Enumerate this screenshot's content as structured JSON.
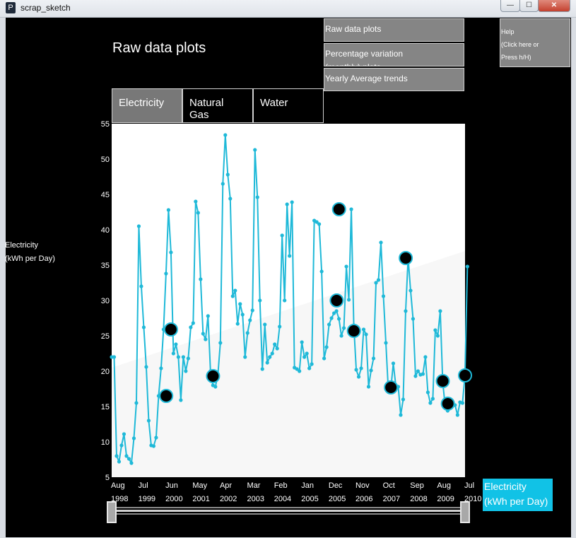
{
  "window": {
    "title": "scrap_sketch",
    "icon_glyph": "P",
    "minimize_glyph": "—",
    "maximize_glyph": "☐",
    "close_glyph": "✕"
  },
  "page": {
    "title": "Raw data plots"
  },
  "nav": {
    "raw": "Raw data plots",
    "percentage_line1": "Percentage variation",
    "percentage_line2": "(monthly) plots",
    "yearly": "Yearly Average trends"
  },
  "help": {
    "line1": "Help",
    "line2": "(Click here or",
    "line3": "Press h/H)"
  },
  "tabs": [
    {
      "label": "Electricity",
      "active": true
    },
    {
      "label": "Natural Gas",
      "active": false
    },
    {
      "label": "Water",
      "active": false
    }
  ],
  "y_title": {
    "line1": "Electricity",
    "line2": "(kWh per Day)"
  },
  "legend": {
    "line1": "Electricity",
    "line2": "(kWh per Day)",
    "color": "#11c2e6"
  },
  "colors": {
    "series": "#1fb9d8",
    "plot_bg": "#ffffff",
    "marker": "#000000"
  },
  "chart_data": {
    "type": "line",
    "title": "",
    "xlabel": "",
    "ylabel": "Electricity (kWh per Day)",
    "ylim": [
      5,
      55
    ],
    "yticks": [
      5,
      10,
      15,
      20,
      25,
      30,
      35,
      40,
      45,
      50,
      55
    ],
    "xlim": [
      1998.58,
      2010.5
    ],
    "xticks": [
      {
        "x": 1998.58,
        "month": "Aug",
        "year": "1998"
      },
      {
        "x": 1999.5,
        "month": "Jul",
        "year": "1999"
      },
      {
        "x": 2000.42,
        "month": "Jun",
        "year": "2000"
      },
      {
        "x": 2001.33,
        "month": "May",
        "year": "2001"
      },
      {
        "x": 2002.25,
        "month": "Apr",
        "year": "2002"
      },
      {
        "x": 2003.17,
        "month": "Mar",
        "year": "2003"
      },
      {
        "x": 2004.08,
        "month": "Feb",
        "year": "2004"
      },
      {
        "x": 2005.0,
        "month": "Jan",
        "year": "2005"
      },
      {
        "x": 2005.92,
        "month": "Dec",
        "year": "2005"
      },
      {
        "x": 2006.83,
        "month": "Nov",
        "year": "2006"
      },
      {
        "x": 2007.75,
        "month": "Oct",
        "year": "2007"
      },
      {
        "x": 2008.67,
        "month": "Sep",
        "year": "2008"
      },
      {
        "x": 2009.58,
        "month": "Aug",
        "year": "2009"
      },
      {
        "x": 2010.5,
        "month": "Jul",
        "year": "2010"
      }
    ],
    "series": [
      {
        "values": [
          22,
          22,
          8,
          7.2,
          9.5,
          11.1,
          8,
          7.6,
          7,
          10.5,
          15.5,
          40.5,
          32,
          26.2,
          20.6,
          13,
          9.5,
          9.4,
          10.6,
          16.5,
          20.4,
          25.9,
          33.8,
          42.8,
          36.8,
          22.5,
          23.8,
          22,
          15.9,
          22,
          20,
          21.8,
          26.2,
          26.8,
          44,
          42.4,
          33,
          25.3,
          24.5,
          27.8,
          20,
          18,
          17.8,
          19.5,
          24,
          46.5,
          53.4,
          47.8,
          44.4,
          30.6,
          31.4,
          26.7,
          29.5,
          28,
          22,
          25.4,
          27.2,
          28.6,
          51.3,
          44.6,
          30,
          20.3,
          26.6,
          21.2,
          22,
          22.5,
          23.8,
          23.2,
          26.3,
          39.2,
          30,
          43.6,
          36.3,
          43.9,
          20.5,
          20.3,
          20,
          24.1,
          22,
          22.5,
          20.4,
          21,
          41.3,
          41.1,
          40.8,
          34.1,
          21.8,
          23.4,
          26.6,
          27.5,
          28.2,
          28.5,
          27.4,
          25,
          26.1,
          34.8,
          30.1,
          42.9,
          26.5,
          20.2,
          19.2,
          20.4,
          25.9,
          25.2,
          17.8,
          20.1,
          21.8,
          32.5,
          32.9,
          38.2,
          30.6,
          24,
          17.2,
          17.5,
          21.1,
          18,
          17.8,
          13.8,
          16,
          28.5,
          36,
          31.4,
          27.4,
          19.3,
          20,
          19.5,
          19.6,
          22,
          17,
          15.5,
          16.1,
          25.8,
          25,
          28.5,
          18.5,
          15,
          14.4,
          15.8,
          15.3,
          15.2,
          13.8,
          15.6,
          15.5,
          19.3,
          34.8
        ]
      }
    ],
    "highlighted": [
      {
        "x": 2000.42,
        "y": 16.5
      },
      {
        "x": 2000.58,
        "y": 25.9
      },
      {
        "x": 2002.0,
        "y": 19.3
      },
      {
        "x": 2006.17,
        "y": 30
      },
      {
        "x": 2006.25,
        "y": 42.9
      },
      {
        "x": 2006.75,
        "y": 25.7
      },
      {
        "x": 2008.0,
        "y": 17.7
      },
      {
        "x": 2008.5,
        "y": 36
      },
      {
        "x": 2009.75,
        "y": 18.6
      },
      {
        "x": 2009.92,
        "y": 15.4
      },
      {
        "x": 2010.5,
        "y": 19.4
      }
    ],
    "grid": false
  }
}
